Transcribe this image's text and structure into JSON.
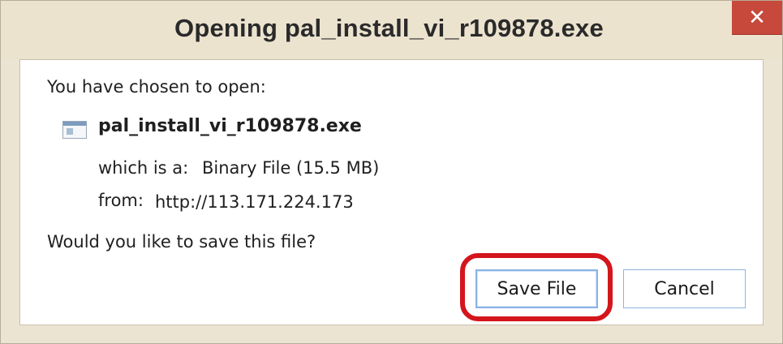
{
  "dialog": {
    "title": "Opening pal_install_vi_r109878.exe",
    "close_label": "✕",
    "intro": "You have chosen to open:",
    "file": {
      "icon": "file-icon",
      "name": "pal_install_vi_r109878.exe",
      "type_label": "which is a:",
      "type_value": "Binary File (15.5 MB)",
      "from_label": "from:",
      "from_value": "http://113.171.224.173"
    },
    "question": "Would you like to save this file?",
    "buttons": {
      "save": "Save File",
      "cancel": "Cancel"
    },
    "highlight_color": "#d4151c"
  }
}
